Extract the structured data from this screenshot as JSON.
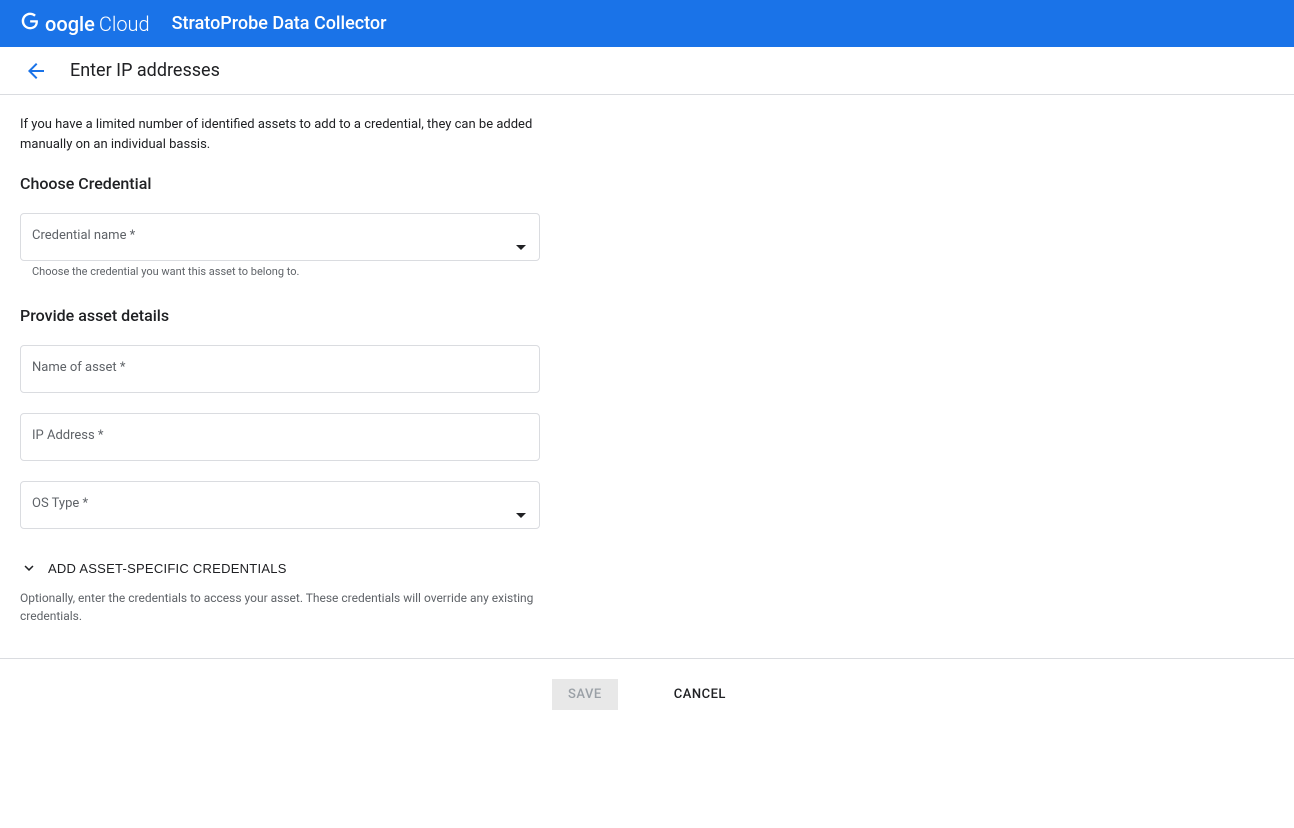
{
  "header": {
    "logo_part1": "Google",
    "logo_part2": "Cloud",
    "product": "StratoProbe Data Collector"
  },
  "subheader": {
    "title": "Enter IP addresses"
  },
  "content": {
    "intro": "If you have a limited number of identified assets to add to a credential, they can be added manually on an individual bassis.",
    "section1_title": "Choose Credential",
    "credential_label": "Credential name *",
    "credential_helper": "Choose the credential you want this asset to belong to.",
    "section2_title": "Provide asset details",
    "asset_name_label": "Name of asset *",
    "ip_address_label": "IP Address *",
    "os_type_label": "OS Type *",
    "expand_label": "ADD ASSET-SPECIFIC CREDENTIALS",
    "expand_description": "Optionally, enter the credentials to access your asset. These credentials will override any existing credentials."
  },
  "footer": {
    "save": "SAVE",
    "cancel": "CANCEL"
  }
}
